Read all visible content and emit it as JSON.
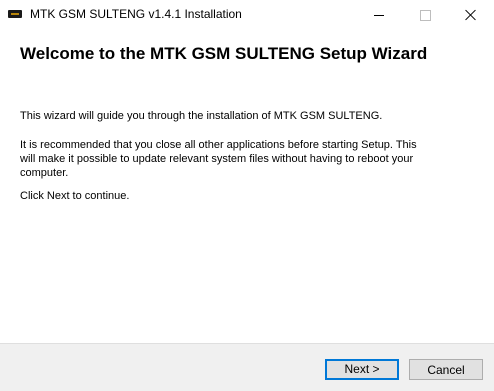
{
  "window": {
    "title": "MTK GSM SULTENG v1.4.1 Installation"
  },
  "content": {
    "heading": "Welcome to the MTK GSM SULTENG Setup Wizard",
    "paragraph1": "This wizard will guide you through the installation of MTK GSM SULTENG.",
    "paragraph2": "It is recommended that you close all other applications before starting Setup. This will make it possible to update relevant system files without having to reboot your computer.",
    "paragraph3": "Click Next to continue."
  },
  "buttons": {
    "next": "Next >",
    "cancel": "Cancel"
  },
  "colors": {
    "accent": "#0078d7",
    "footer_bg": "#f0f0f0"
  }
}
